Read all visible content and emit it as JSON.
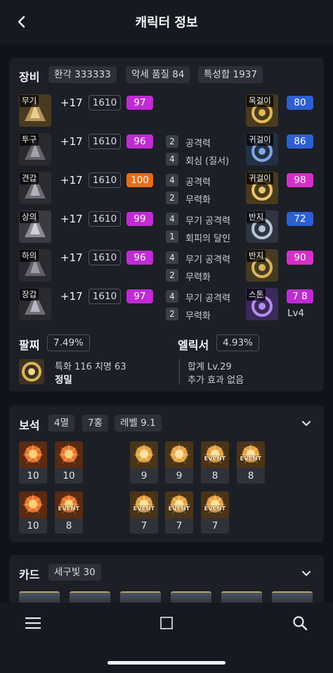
{
  "header": {
    "title": "캐릭터 정보"
  },
  "equipment": {
    "title": "장비",
    "summary_chips": [
      "환각 333333",
      "악세 품질 84",
      "특성합 1937"
    ],
    "armor": [
      {
        "slot": "무기",
        "refine": "+17",
        "item_level": "1610",
        "quality": "97",
        "quality_color": "#c02bd3",
        "effects": []
      },
      {
        "slot": "투구",
        "refine": "+17",
        "item_level": "1610",
        "quality": "96",
        "quality_color": "#c02bd3",
        "effects": [
          {
            "count": "2",
            "text": "공격력"
          },
          {
            "count": "4",
            "text": "회심 (질서)"
          }
        ]
      },
      {
        "slot": "견갑",
        "refine": "+17",
        "item_level": "1610",
        "quality": "100",
        "quality_color": "#e76d1c",
        "effects": [
          {
            "count": "4",
            "text": "공격력"
          },
          {
            "count": "2",
            "text": "무력화"
          }
        ]
      },
      {
        "slot": "상의",
        "refine": "+17",
        "item_level": "1610",
        "quality": "99",
        "quality_color": "#c02bd3",
        "effects": [
          {
            "count": "4",
            "text": "무기 공격력"
          },
          {
            "count": "1",
            "text": "회피의 달인"
          }
        ]
      },
      {
        "slot": "하의",
        "refine": "+17",
        "item_level": "1610",
        "quality": "96",
        "quality_color": "#c02bd3",
        "effects": [
          {
            "count": "4",
            "text": "무기 공격력"
          },
          {
            "count": "2",
            "text": "무력화"
          }
        ]
      },
      {
        "slot": "장갑",
        "refine": "+17",
        "item_level": "1610",
        "quality": "97",
        "quality_color": "#c02bd3",
        "effects": [
          {
            "count": "4",
            "text": "무기 공격력"
          },
          {
            "count": "2",
            "text": "무력화"
          }
        ]
      }
    ],
    "accessories": [
      {
        "slot": "목걸이",
        "quality": "80",
        "quality_color": "#2d5fd2"
      },
      {
        "slot": "귀걸이",
        "quality": "86",
        "quality_color": "#2d5fd2"
      },
      {
        "slot": "귀걸이",
        "quality": "98",
        "quality_color": "#d62fc8"
      },
      {
        "slot": "반지",
        "quality": "72",
        "quality_color": "#2d5fd2"
      },
      {
        "slot": "반지",
        "quality": "90",
        "quality_color": "#d62fc8"
      },
      {
        "slot": "스톤",
        "quality": "7 8",
        "quality_color": "#c02bd3",
        "sub": "Lv4"
      }
    ],
    "bracelet": {
      "title": "팔찌",
      "percent": "7.49%",
      "stats": "특화 116  치명 63",
      "grade": "정밀"
    },
    "elixir": {
      "title": "엘릭서",
      "percent": "4.93%",
      "total": "합계 Lv.29",
      "extra": "추가 효과 없음"
    }
  },
  "gems": {
    "title": "보석",
    "chips": [
      "4멸",
      "7홍",
      "레벨 9.1"
    ],
    "event_label": "EVENT",
    "items": [
      {
        "level": "10",
        "event": false,
        "tone": "red"
      },
      {
        "level": "10",
        "event": false,
        "tone": "red"
      },
      {
        "level": "9",
        "event": false,
        "tone": "amber"
      },
      {
        "level": "9",
        "event": false,
        "tone": "amber"
      },
      {
        "level": "8",
        "event": true,
        "tone": "amber"
      },
      {
        "level": "8",
        "event": true,
        "tone": "amber"
      },
      {
        "level": "10",
        "event": false,
        "tone": "red"
      },
      {
        "level": "8",
        "event": true,
        "tone": "red"
      },
      {
        "level": "7",
        "event": true,
        "tone": "amber"
      },
      {
        "level": "7",
        "event": true,
        "tone": "amber"
      },
      {
        "level": "7",
        "event": true,
        "tone": "amber"
      }
    ]
  },
  "cards": {
    "title": "카드",
    "chip": "세구빛 30"
  },
  "bottom_nav": {
    "items": [
      "menu-icon",
      "home-icon",
      "search-icon"
    ]
  }
}
